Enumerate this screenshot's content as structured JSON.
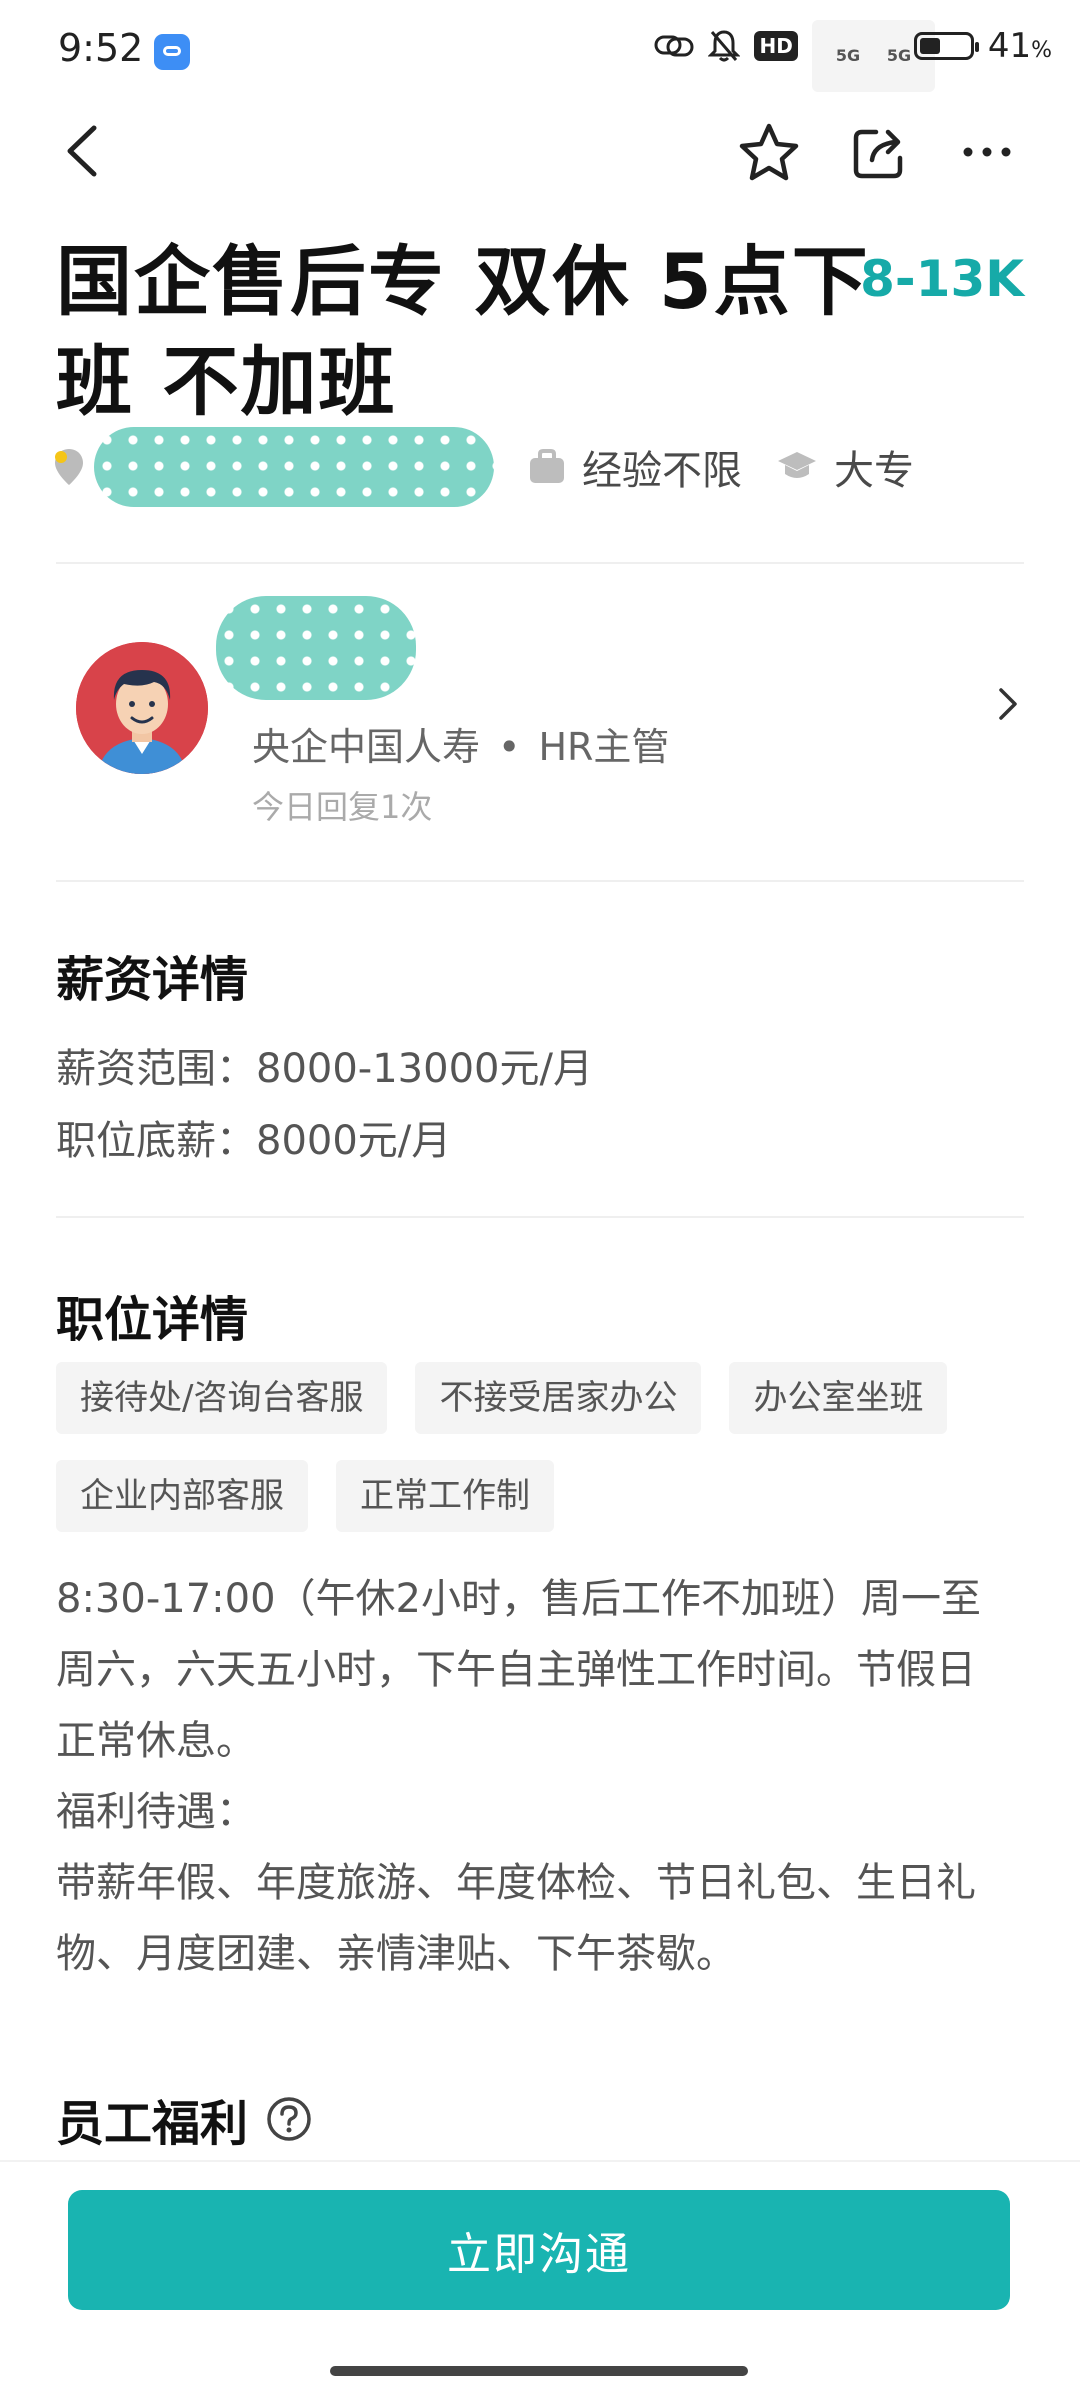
{
  "status_bar": {
    "time": "9:52",
    "network_badge": "HD",
    "sim1": "5G",
    "sim2": "5G",
    "battery_percent": "41",
    "battery_unit": "%",
    "battery_level": 0.41
  },
  "nav": {
    "back_icon": "chevron-left-icon",
    "favorite_icon": "star-icon",
    "share_icon": "share-icon",
    "more_icon": "more-dots-icon"
  },
  "job": {
    "title": "国企售后专 双休 5点下班 不加班",
    "salary": "8-13K",
    "experience": "经验不限",
    "education": "大专"
  },
  "recruiter": {
    "company": "央企中国人寿",
    "separator": "•",
    "role": "HR主管",
    "reply": "今日回复1次"
  },
  "salary_details": {
    "title": "薪资详情",
    "range": "薪资范围：8000-13000元/月",
    "base": "职位底薪：8000元/月"
  },
  "job_details": {
    "title": "职位详情",
    "tags": [
      "接待处/咨询台客服",
      "不接受居家办公",
      "办公室坐班",
      "企业内部客服",
      "正常工作制"
    ],
    "description": "8:30-17:00（午休2小时，售后工作不加班）周一至\n周六，六天五小时，下午自主弹性工作时间。节假日\n正常休息。\n福利待遇：\n带薪年假、年度旅游、年度体检、节日礼包、生日礼\n物、月度团建、亲情津贴、下午茶歇。"
  },
  "benefits": {
    "title": "员工福利"
  },
  "cta": {
    "label": "立即沟通"
  },
  "colors": {
    "accent": "#16aaa8",
    "button": "#19b4b1"
  }
}
